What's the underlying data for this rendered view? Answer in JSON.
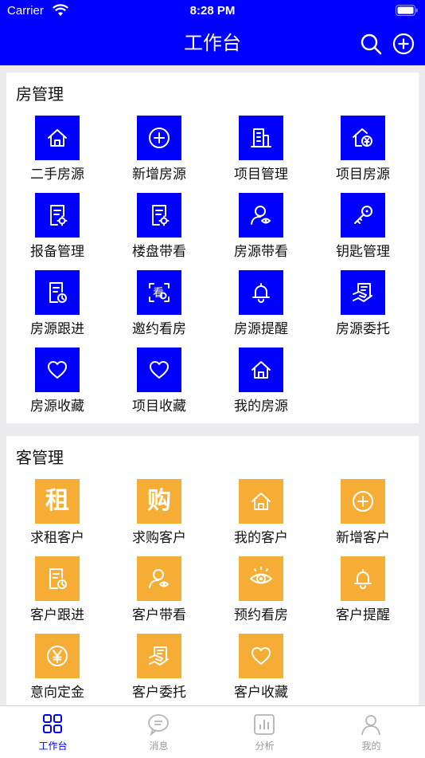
{
  "status_bar": {
    "carrier": "Carrier",
    "time": "8:28 PM"
  },
  "nav": {
    "title": "工作台"
  },
  "colors": {
    "primary": "#0000ff",
    "accent": "#f5ad35"
  },
  "sections": [
    {
      "title": "房管理",
      "items": [
        {
          "label": "二手房源",
          "icon": "house-icon"
        },
        {
          "label": "新增房源",
          "icon": "plus-circle-icon"
        },
        {
          "label": "项目管理",
          "icon": "building-icon"
        },
        {
          "label": "项目房源",
          "icon": "house-yen-icon"
        },
        {
          "label": "报备管理",
          "icon": "document-gear-icon"
        },
        {
          "label": "楼盘带看",
          "icon": "document-gear-icon"
        },
        {
          "label": "房源带看",
          "icon": "person-eye-icon"
        },
        {
          "label": "钥匙管理",
          "icon": "key-icon"
        },
        {
          "label": "房源跟进",
          "icon": "document-clock-icon"
        },
        {
          "label": "邀约看房",
          "icon": "scan-view-icon",
          "glyph": "看"
        },
        {
          "label": "房源提醒",
          "icon": "bell-icon"
        },
        {
          "label": "房源委托",
          "icon": "hand-document-icon"
        },
        {
          "label": "房源收藏",
          "icon": "heart-icon"
        },
        {
          "label": "项目收藏",
          "icon": "heart-icon"
        },
        {
          "label": "我的房源",
          "icon": "house-icon"
        }
      ]
    },
    {
      "title": "客管理",
      "items": [
        {
          "label": "求租客户",
          "icon": "rent-char-icon",
          "glyph": "租"
        },
        {
          "label": "求购客户",
          "icon": "buy-char-icon",
          "glyph": "购"
        },
        {
          "label": "我的客户",
          "icon": "house-icon"
        },
        {
          "label": "新增客户",
          "icon": "plus-circle-icon"
        },
        {
          "label": "客户跟进",
          "icon": "document-clock-icon"
        },
        {
          "label": "客户带看",
          "icon": "person-eye-icon"
        },
        {
          "label": "预约看房",
          "icon": "eye-icon"
        },
        {
          "label": "客户提醒",
          "icon": "bell-icon"
        },
        {
          "label": "意向定金",
          "icon": "yen-circle-icon"
        },
        {
          "label": "客户委托",
          "icon": "hand-document-icon"
        },
        {
          "label": "客户收藏",
          "icon": "heart-icon"
        }
      ]
    }
  ],
  "tabbar": [
    {
      "label": "工作台",
      "icon": "grid-icon",
      "active": true
    },
    {
      "label": "消息",
      "icon": "chat-bubble-icon",
      "active": false
    },
    {
      "label": "分析",
      "icon": "bar-chart-icon",
      "active": false
    },
    {
      "label": "我的",
      "icon": "person-icon",
      "active": false
    }
  ]
}
